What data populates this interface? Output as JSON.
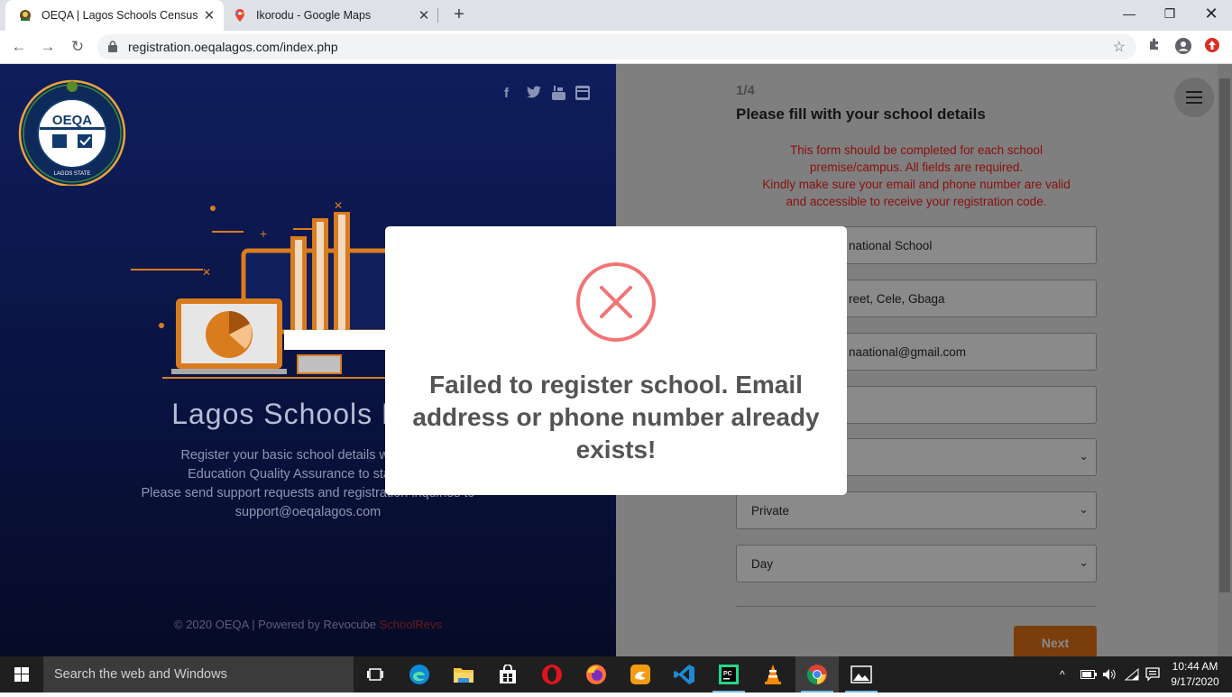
{
  "browser": {
    "tabs": [
      {
        "title": "OEQA | Lagos Schools Census",
        "active": true,
        "favicon": "lagos-crest-icon"
      },
      {
        "title": "Ikorodu - Google Maps",
        "active": false,
        "favicon": "maps-pin-icon"
      }
    ],
    "url": "registration.oeqalagos.com/index.php"
  },
  "left_panel": {
    "logo_text": "OEQA",
    "logo_ring_text": "OFFICE OF EDUCATION QUALITY ASSURANCE",
    "logo_state": "LAGOS STATE",
    "social_icons": [
      "facebook-icon",
      "twitter-icon",
      "youtube-icon",
      "instagram-icon"
    ],
    "title": "Lagos Schools Regi",
    "desc_line1": "Register your basic school details with the L",
    "desc_line2": "Education Quality Assurance to start the r",
    "desc_line3": "Please send support requests and registration inquiries to",
    "desc_line4": "support@oeqalagos.com",
    "footer_prefix": "© 2020 OEQA | Powered by Revocube ",
    "footer_brand": "SchoolRevs"
  },
  "form": {
    "step": "1/4",
    "title": "Please fill with your school details",
    "notice_line1": "This form should be completed for each school",
    "notice_line2": "premise/campus. All fields are required.",
    "notice_line3": "Kindly make sure your email and phone number are valid",
    "notice_line4": "and accessible to receive your registration code.",
    "field_school_name": "national School",
    "field_address": "reet, Cele, Gbaga",
    "field_email": "naational@gmail.com",
    "field_phone": "",
    "select_lga": "",
    "select_ownership": "Private",
    "select_type": "Day",
    "next_label": "Next"
  },
  "modal": {
    "icon": "error-x-icon",
    "message": "Failed to register school. Email address or phone number already exists!",
    "accent": "#f27474"
  },
  "taskbar": {
    "search_placeholder": "Search the web and Windows",
    "time": "10:44 AM",
    "date": "9/17/2020",
    "apps": [
      "task-view-icon",
      "edge-icon",
      "file-explorer-icon",
      "store-icon",
      "opera-icon",
      "firefox-icon",
      "uc-browser-icon",
      "vscode-icon",
      "pycharm-icon",
      "vlc-icon",
      "chrome-icon",
      "photos-icon"
    ]
  },
  "colors": {
    "left_bg": "#0f1e5c",
    "accent_orange": "#d97c1e",
    "notice_red": "#c0392b"
  }
}
